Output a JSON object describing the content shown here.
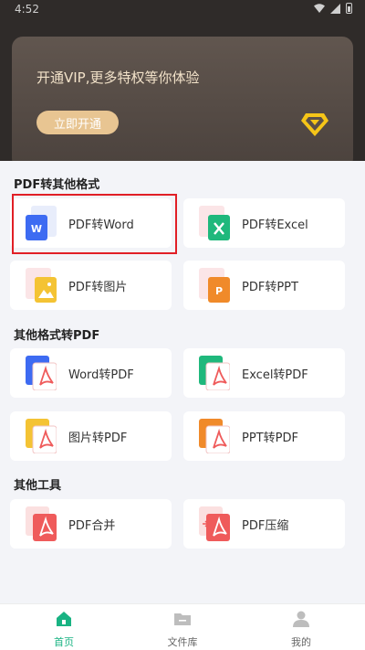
{
  "status_bar": {
    "time": "4:52"
  },
  "vip": {
    "promo_text": "开通VIP,更多特权等你体验",
    "button_label": "立即开通"
  },
  "sections": [
    {
      "title": "PDF转其他格式",
      "items": [
        {
          "label": "PDF转Word",
          "icon": "word-file-icon",
          "accent": "#3d6bf2"
        },
        {
          "label": "PDF转Excel",
          "icon": "excel-file-icon",
          "accent": "#1fb87c"
        },
        {
          "label": "PDF转图片",
          "icon": "image-file-icon",
          "accent": "#f4c334"
        },
        {
          "label": "PDF转PPT",
          "icon": "ppt-file-icon",
          "accent": "#f08a2a"
        }
      ]
    },
    {
      "title": "其他格式转PDF",
      "items": [
        {
          "label": "Word转PDF",
          "icon": "word-to-pdf-icon",
          "accent": "#3d6bf2"
        },
        {
          "label": "Excel转PDF",
          "icon": "excel-to-pdf-icon",
          "accent": "#1fb87c"
        },
        {
          "label": "图片转PDF",
          "icon": "image-to-pdf-icon",
          "accent": "#f4c334"
        },
        {
          "label": "PPT转PDF",
          "icon": "ppt-to-pdf-icon",
          "accent": "#f08a2a"
        }
      ]
    },
    {
      "title": "其他工具",
      "items": [
        {
          "label": "PDF合并",
          "icon": "pdf-merge-icon",
          "accent": "#ef5b5b"
        },
        {
          "label": "PDF压缩",
          "icon": "pdf-compress-icon",
          "accent": "#ef5b5b"
        }
      ]
    }
  ],
  "bottom_nav": [
    {
      "label": "首页",
      "icon": "home-icon",
      "active": true
    },
    {
      "label": "文件库",
      "icon": "folder-icon",
      "active": false
    },
    {
      "label": "我的",
      "icon": "user-icon",
      "active": false
    }
  ],
  "colors": {
    "active_tab": "#19b383",
    "highlight_border": "#e11f26",
    "vip_gold": "#e8c592",
    "pdf_red": "#ef5b5b"
  }
}
